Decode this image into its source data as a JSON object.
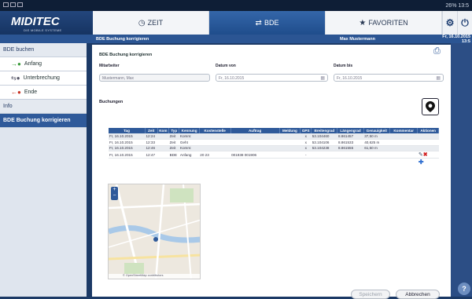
{
  "statusbar": {
    "right": "26% 13:5"
  },
  "logo": {
    "name": "MIDITEC",
    "tagline": "DIE MOBILE SYSTEME"
  },
  "nav": {
    "tabs": [
      {
        "label": "ZEIT",
        "icon": "clock-icon"
      },
      {
        "label": "BDE",
        "icon": "bde-icon"
      },
      {
        "label": "FAVORITEN",
        "icon": "star-icon"
      }
    ],
    "gear": "⚙",
    "power": "⏻"
  },
  "subbar": {
    "title": "BDE Buchung korrigieren",
    "user": "Max Mustermann",
    "date": "Fr, 16.10.2015 13:5"
  },
  "sidebar": {
    "section": "BDE buchen",
    "items": [
      {
        "label": "Anfang",
        "icon": "arrow-in-icon"
      },
      {
        "label": "Unterbrechung",
        "icon": "pause-icon"
      },
      {
        "label": "Ende",
        "icon": "arrow-out-icon"
      }
    ],
    "info": "Info",
    "active": "BDE Buchung korrigieren"
  },
  "form": {
    "page_title": "BDE Buchung korrigieren",
    "mitarbeiter_label": "Mitarbeiter",
    "mitarbeiter_value": "Mustermann, Max",
    "datum_von_label": "Datum von",
    "datum_von_value": "Fr, 16.10.2015",
    "datum_bis_label": "Datum bis",
    "datum_bis_value": "Fr, 16.10.2015",
    "buchungen_label": "Buchungen"
  },
  "table": {
    "headers": [
      "Tag",
      "Zeit",
      "Kom",
      "Typ",
      "Kennung",
      "Kostenstelle",
      "Auftrag",
      "Meldung",
      "GPS",
      "Breitengrad",
      "Längengrad",
      "Genauigkeit",
      "Kommentar",
      "Aktionen"
    ],
    "rows": [
      [
        "Fr, 16.10.2015",
        "12:24",
        "",
        "Zeit",
        "Komm:",
        "",
        "",
        "",
        "x",
        "53.104460",
        "8.861457",
        "37,50 m",
        "",
        ""
      ],
      [
        "Fr, 16.10.2015",
        "12:33",
        "",
        "Zeit",
        "Geht",
        "",
        "",
        "",
        "x",
        "53.104106",
        "8.861533",
        "40,625 m",
        "",
        ""
      ],
      [
        "Fr, 16.10.2015",
        "12:46",
        "",
        "Zeit",
        "Komm:",
        "",
        "",
        "",
        "x",
        "53.104238",
        "8.861555",
        "61,50 m",
        "",
        ""
      ],
      [
        "Fr, 16.10.2015",
        "12:47",
        "",
        "BDE",
        "Anfang",
        "20 23",
        "001938 001906",
        "",
        "-",
        "",
        "",
        "",
        "",
        ""
      ]
    ]
  },
  "map": {
    "attribution": "© OpenStreetMap contributors"
  },
  "buttons": {
    "save": "Speichern",
    "cancel": "Abbrechen"
  },
  "help": "?"
}
